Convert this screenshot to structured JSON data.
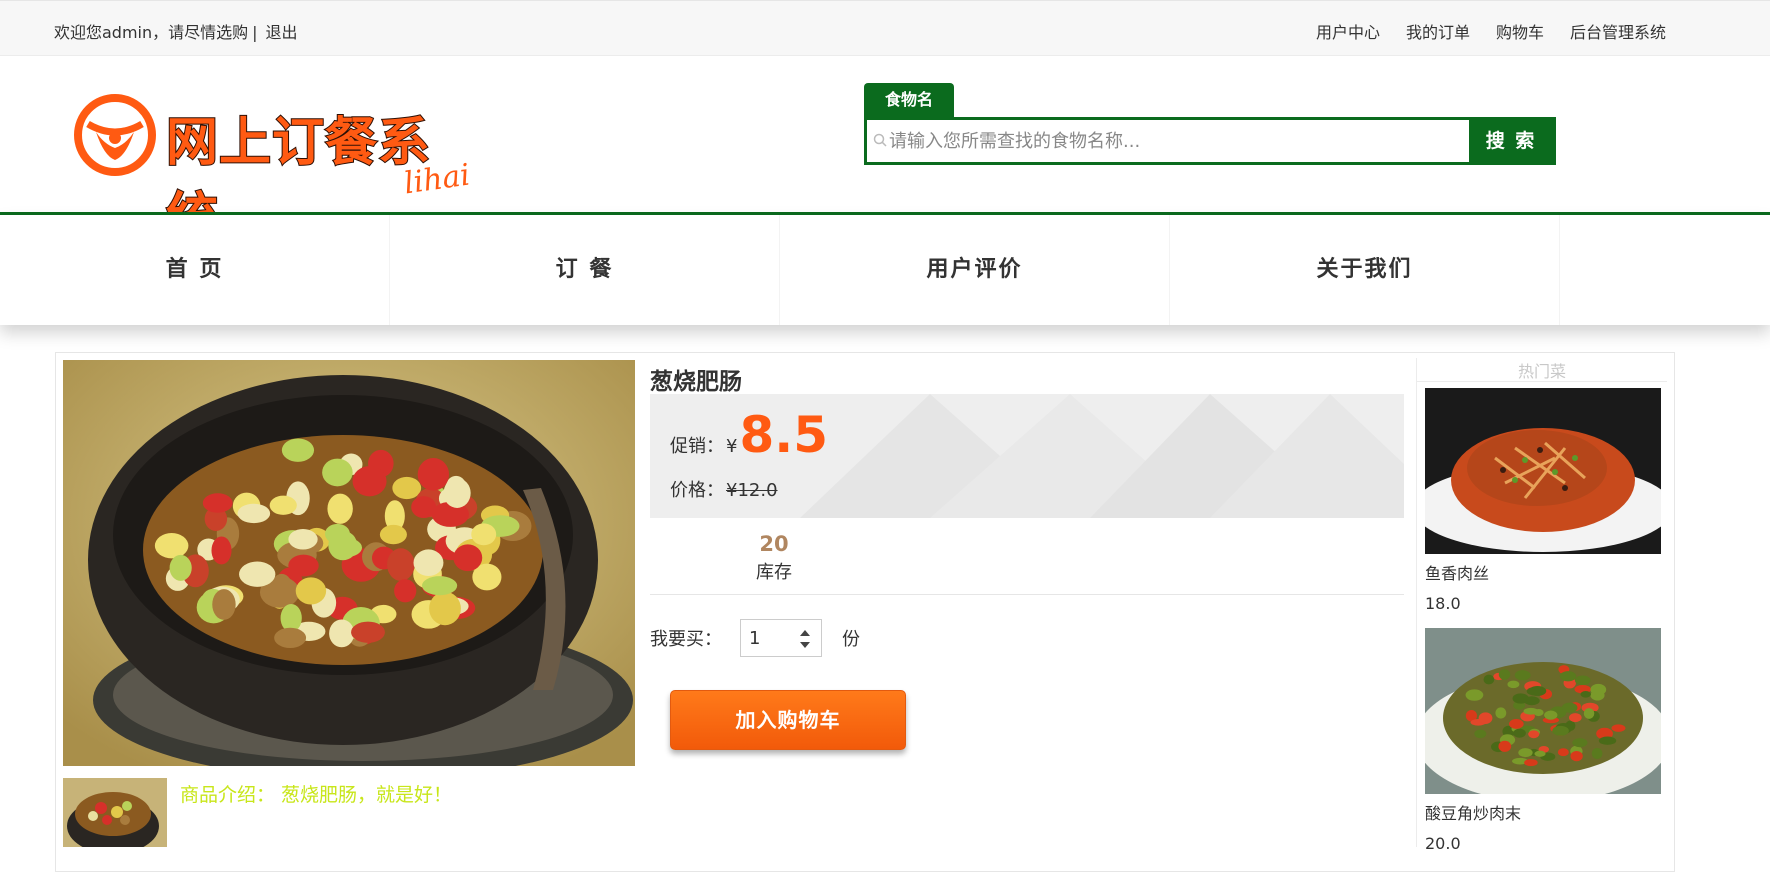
{
  "topbar": {
    "welcome": "欢迎您admin，请尽情选购",
    "separator": "|",
    "logout": "退出",
    "links": [
      "用户中心",
      "我的订单",
      "购物车",
      "后台管理系统"
    ]
  },
  "logo": {
    "title": "网上订餐系统",
    "signature": "lihai"
  },
  "search": {
    "tab": "食物名",
    "placeholder": "请输入您所需查找的食物名称...",
    "button": "搜 索"
  },
  "nav": [
    "首 页",
    "订 餐",
    "用户评价",
    "关于我们"
  ],
  "product": {
    "name": "葱烧肥肠",
    "promo_label": "促销：",
    "currency": "¥",
    "promo_price": "8.5",
    "price_label": "价格：",
    "original_price": "12.0",
    "stock": "20",
    "stock_label": "库存",
    "buy_label": "我要买：",
    "quantity": "1",
    "unit": "份",
    "add_to_cart": "加入购物车",
    "description": "商品介绍：  葱烧肥肠，就是好！"
  },
  "hot": {
    "title": "热门菜",
    "items": [
      {
        "name": "鱼香肉丝",
        "price": "18.0"
      },
      {
        "name": "酸豆角炒肉末",
        "price": "20.0"
      }
    ]
  },
  "colors": {
    "brand_green": "#0b6b1e",
    "accent_orange": "#ff5a12",
    "description_text": "#c8e61a",
    "stock_number": "#b08660"
  }
}
